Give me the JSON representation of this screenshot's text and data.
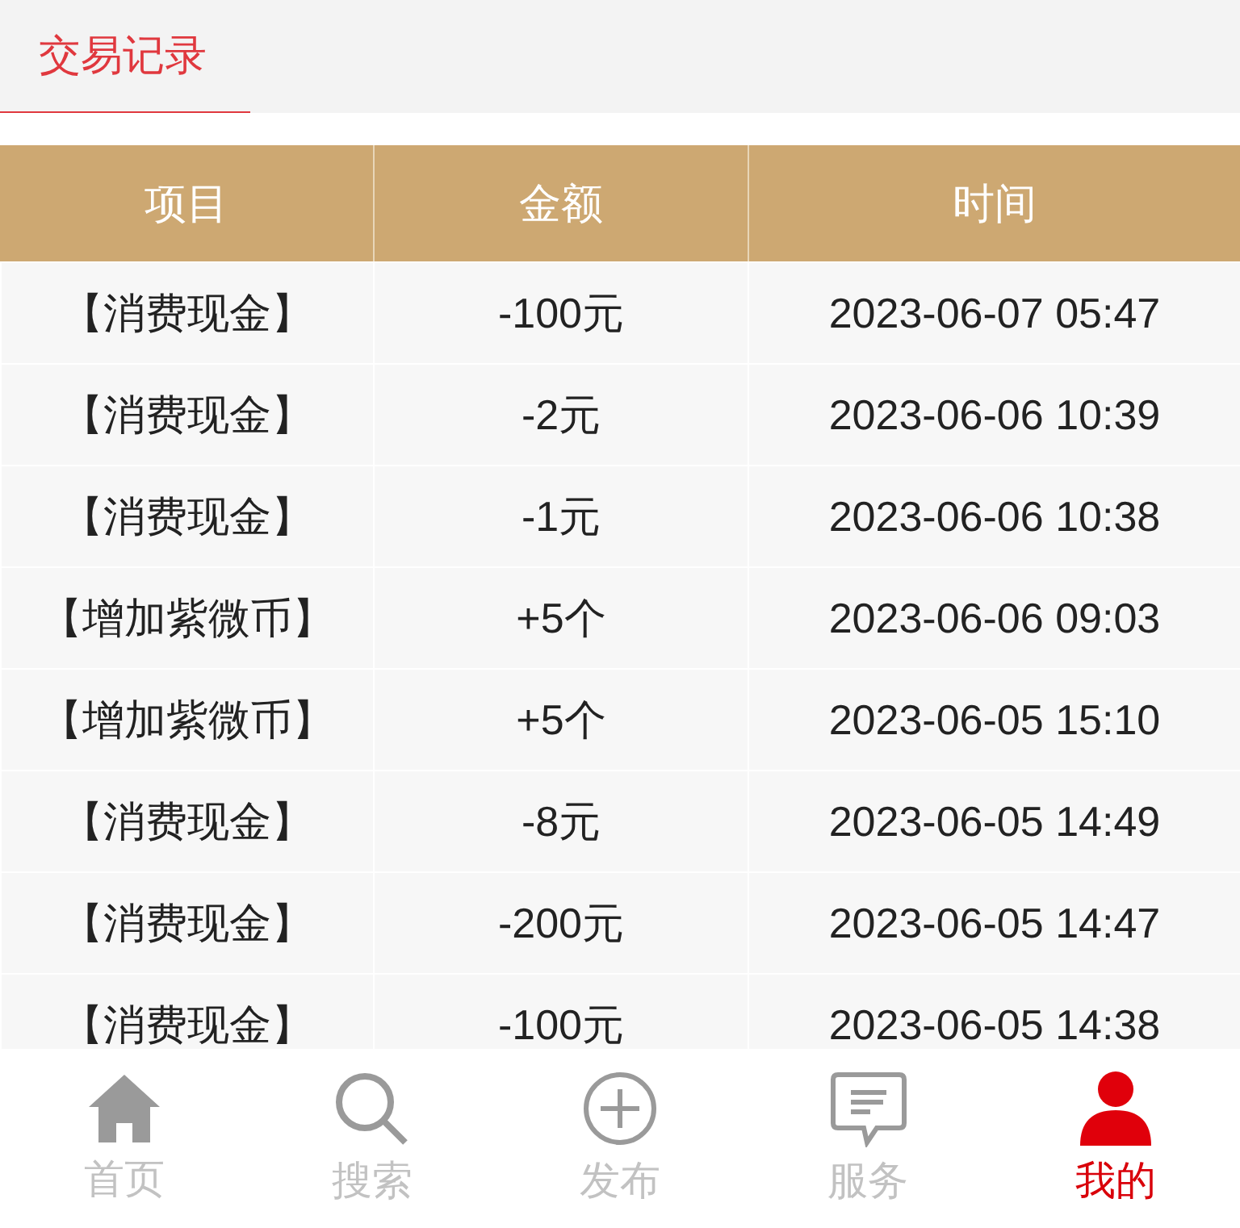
{
  "tabs": [
    {
      "label": "交易记录",
      "selected": true
    }
  ],
  "table": {
    "columns": [
      "项目",
      "金额",
      "时间"
    ],
    "rows": [
      [
        "【消费现金】",
        "-100元",
        "2023-06-07 05:47"
      ],
      [
        "【消费现金】",
        "-2元",
        "2023-06-06 10:39"
      ],
      [
        "【消费现金】",
        "-1元",
        "2023-06-06 10:38"
      ],
      [
        "【增加紫微币】",
        "+5个",
        "2023-06-06 09:03"
      ],
      [
        "【增加紫微币】",
        "+5个",
        "2023-06-05 15:10"
      ],
      [
        "【消费现金】",
        "-8元",
        "2023-06-05 14:49"
      ],
      [
        "【消费现金】",
        "-200元",
        "2023-06-05 14:47"
      ],
      [
        "【消费现金】",
        "-100元",
        "2023-06-05 14:38"
      ]
    ]
  },
  "nav": [
    {
      "label": "首页",
      "kind": "home",
      "selected": false
    },
    {
      "label": "搜索",
      "kind": "search",
      "selected": false
    },
    {
      "label": "发布",
      "kind": "publish",
      "selected": false
    },
    {
      "label": "服务",
      "kind": "service",
      "selected": false
    },
    {
      "label": "我的",
      "kind": "profile",
      "selected": true
    }
  ]
}
